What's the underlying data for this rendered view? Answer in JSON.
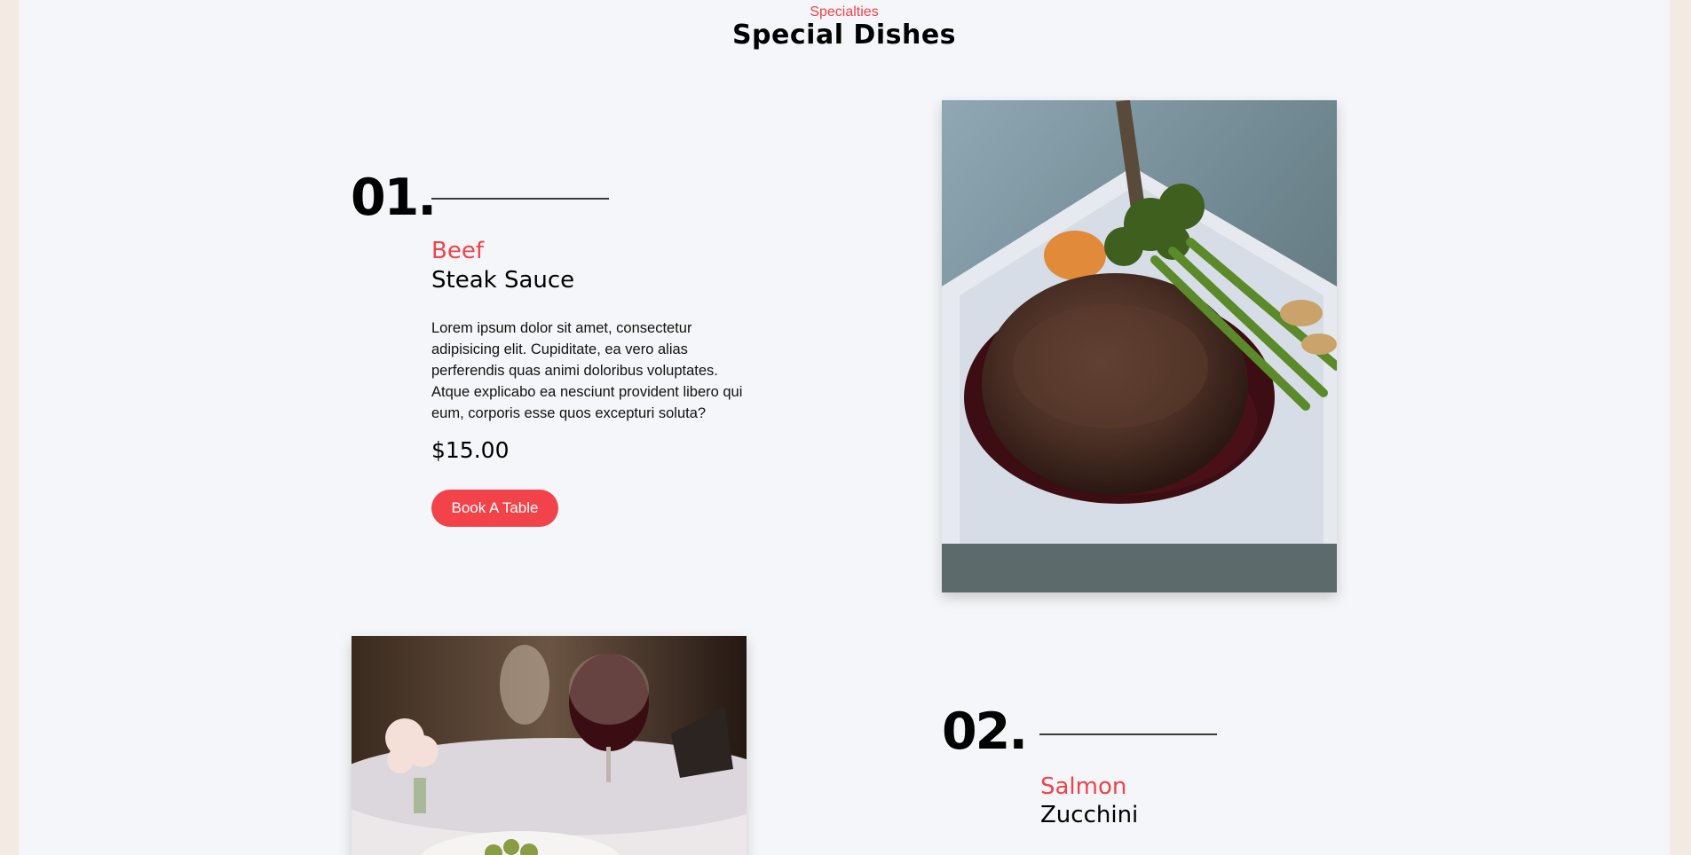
{
  "section": {
    "eyebrow": "Specialties",
    "title": "Special Dishes"
  },
  "dishes": [
    {
      "number": "01.",
      "category": "Beef",
      "name": "Steak Sauce",
      "description": "Lorem ipsum dolor sit amet, consectetur adipisicing elit. Cupiditate, ea vero alias perferendis quas animi doloribus voluptates. Atque explicabo ea nesciunt provident libero qui eum, corporis esse quos excepturi soluta?",
      "price": "$15.00",
      "button_label": "Book A Table",
      "image": "steak-with-broccolini-photo"
    },
    {
      "number": "02.",
      "category": "Salmon",
      "name": "Zucchini",
      "image": "restaurant-table-with-wine-photo"
    }
  ],
  "colors": {
    "accent": "#f2434a",
    "background": "#f5f6f9",
    "outer": "#f3ebe3",
    "text": "#000000"
  }
}
